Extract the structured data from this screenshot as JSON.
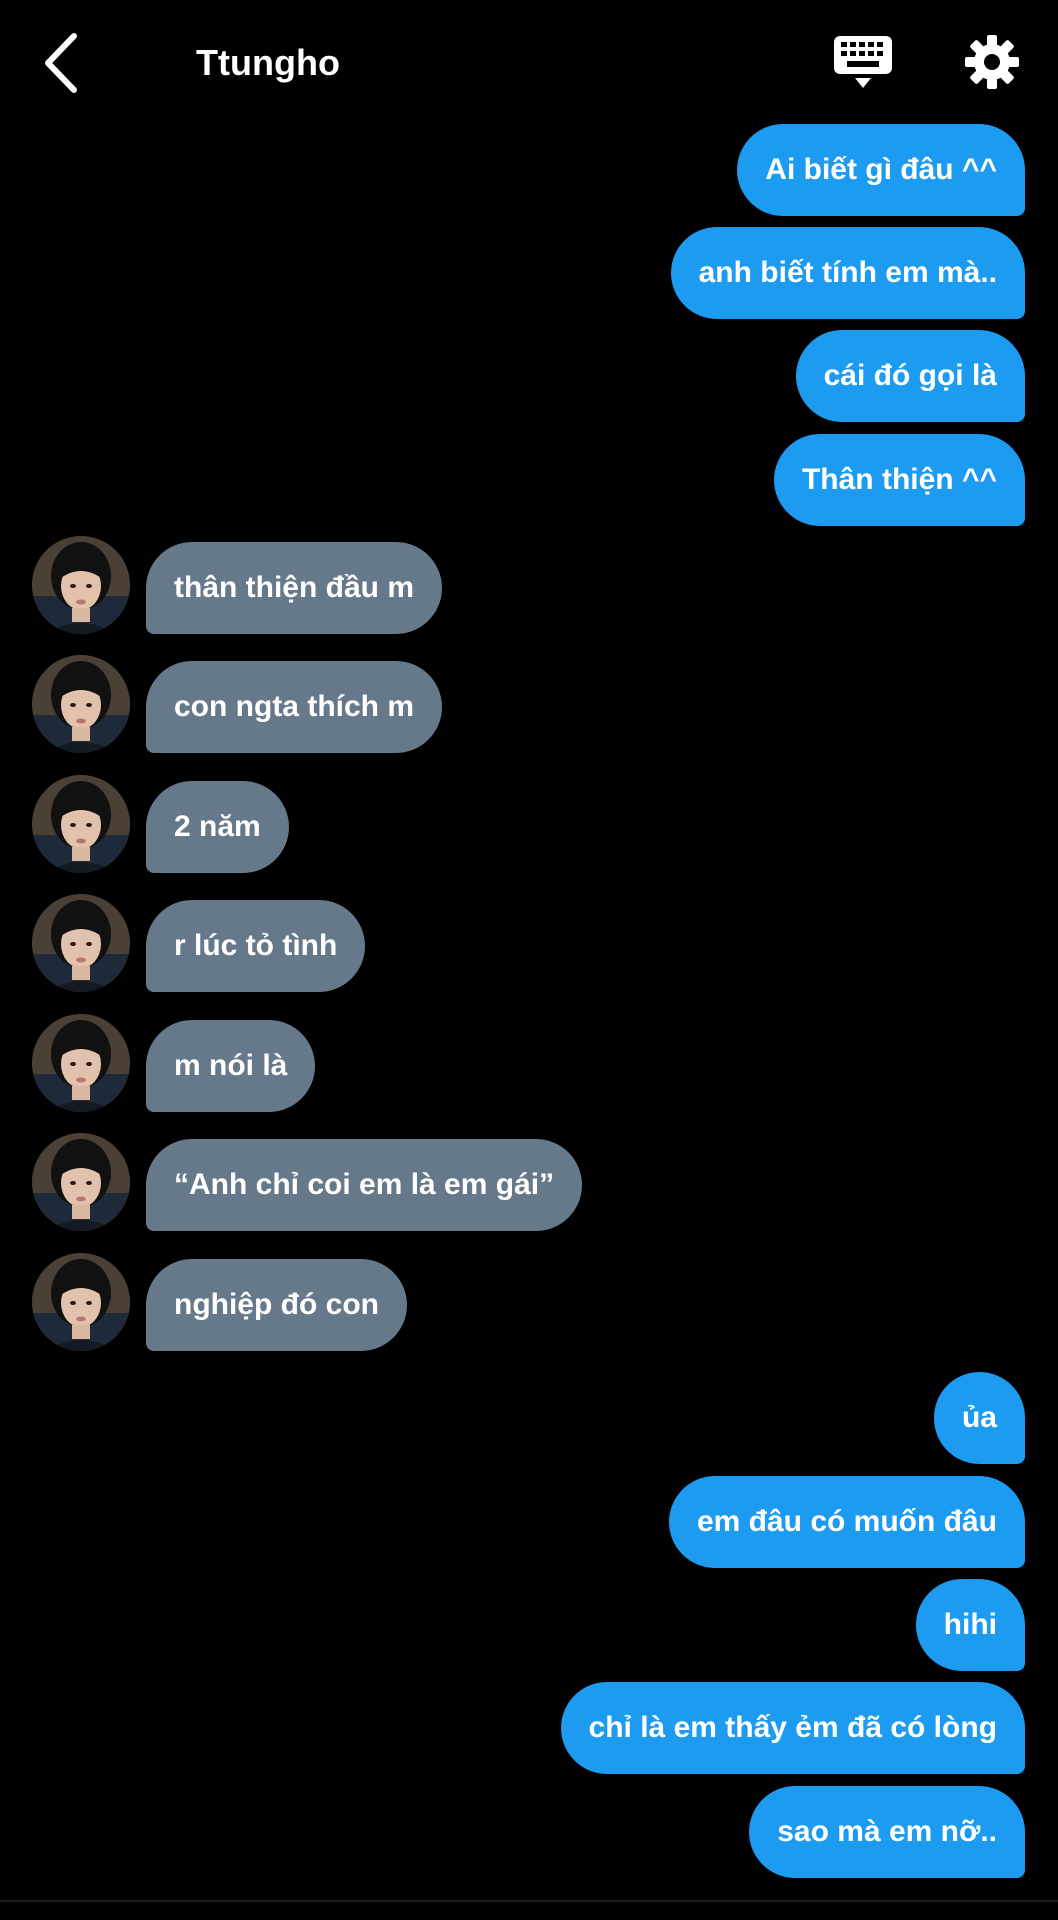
{
  "header": {
    "title": "Ttungho",
    "back_icon": "chevron-left-icon",
    "keyboard_icon": "keyboard-icon",
    "settings_icon": "gear-icon"
  },
  "colors": {
    "background": "#000000",
    "outgoing_bubble": "#1d9bf0",
    "incoming_bubble": "#66798b",
    "text": "#ffffff"
  },
  "messages": [
    {
      "side": "out",
      "text": "Ai biết gì đâu ^^"
    },
    {
      "side": "out",
      "text": "anh biết tính em mà.."
    },
    {
      "side": "out",
      "text": "cái đó gọi là"
    },
    {
      "side": "out",
      "text": "Thân thiện ^^"
    },
    {
      "side": "in",
      "text": "thân thiện đầu m"
    },
    {
      "side": "in",
      "text": "con ngta thích m"
    },
    {
      "side": "in",
      "text": "2 năm"
    },
    {
      "side": "in",
      "text": "r lúc tỏ tình"
    },
    {
      "side": "in",
      "text": "m nói là"
    },
    {
      "side": "in",
      "text": "“Anh chỉ coi em là em gái”"
    },
    {
      "side": "in",
      "text": "nghiệp đó con"
    },
    {
      "side": "out",
      "text": "ủa"
    },
    {
      "side": "out",
      "text": "em đâu có muốn đâu"
    },
    {
      "side": "out",
      "text": "hihi"
    },
    {
      "side": "out",
      "text": "chỉ là em thấy ẻm đã có lòng"
    },
    {
      "side": "out",
      "text": "sao mà em nỡ.."
    }
  ]
}
